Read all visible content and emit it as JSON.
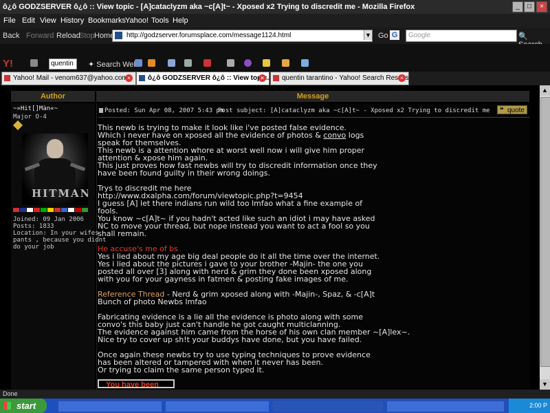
{
  "window": {
    "title": "ô¿ô GODZSERVER ô¿ô :: View topic - [A]cataclyzm aka ~c[A]t~ - Xposed x2 Trying to discredit me - Mozilla Firefox",
    "minimize": "_",
    "maximize": "□",
    "close": "×"
  },
  "menu": [
    "File",
    "Edit",
    "View",
    "History",
    "Bookmarks",
    "Yahoo!",
    "Tools",
    "Help"
  ],
  "nav": {
    "back": "Back",
    "forward": "Forward",
    "reload": "Reload",
    "stop": "Stop",
    "home": "Home",
    "url": "http://godzserver.forumsplace.com/message1124.html",
    "go": "Go",
    "search_placeholder": "Google",
    "search_button": "Search"
  },
  "yahoo_toolbar": {
    "logo": "Y!",
    "query": "quentin",
    "search_web": "Search Web"
  },
  "tabs": [
    {
      "label": "Yahoo! Mail - venom637@yahoo.com",
      "active": false
    },
    {
      "label": "ô¿ô GODZSERVER ô¿ô :: View topic...",
      "active": true
    },
    {
      "label": "quentin tarantino - Yahoo! Search Results",
      "active": false
    }
  ],
  "table_header": {
    "author": "Author",
    "message": "Message"
  },
  "author": {
    "name": "~»Hit[]Màn«~",
    "rank": "Major O-4",
    "avatar_logo": "HITMAN",
    "joined": "Joined: 09 Jan 2006",
    "posts": "Posts: 1833",
    "location_1": "Location: In your wifes",
    "location_2": "pants , because you didnt",
    "location_3": "do your job"
  },
  "post": {
    "posted": "Posted: Sun Apr 08, 2007 5:43 pm",
    "subject": "Post subject: [A]cataclyzm aka ~c[A]t~ - Xposed x2 Trying to discredit me",
    "quote": "quote",
    "l01": "This newb is trying to make it look like i've posted false evidence.",
    "l02a": "Which i never have on xposed all the evidence of photos & ",
    "l02b": "convo",
    "l02c": " logs",
    "l03": "speak for themselves.",
    "l04": "This newb is a attention whore at worst well now i will give him proper",
    "l05": "attention & xpose him again.",
    "l06": "This just proves how fast newbs will try to discredit information once they",
    "l07": "have been found guilty in their wrong doings.",
    "l08": "Trys to discredit me here",
    "l09": "http://www.dxalpha.com/forum/viewtopic.php?t=9454",
    "l10": "I guess [A] let there indians run wild too lmfao what a fine example of",
    "l11": "fools.",
    "l12": "You know ~c[A]t~ if you hadn't acted like such an idiot i may have asked",
    "l13": "NC to move your thread, but nope instead you want to act a fool so you",
    "l14": "shall remain.",
    "l15": "He accuse's me of bs",
    "l16": "Yes i lied about my age big deal people do it all the time over the internet.",
    "l17": "Yes i lied about the pictures i gave to your brother -Majin- the one you",
    "l18": "posted all over [3] along with nerd & grim they done been xposed along",
    "l19": "with you for your gayness in fatmen & posting fake images of me.",
    "l20a": "Reference Thread",
    "l20b": " - Nerd & grim xposed along with -Majin-, Spaz, & -c[A]t",
    "l21": "Bunch of photo Newbs lmfao",
    "l22": "Fabricating evidence is a lie all the evidence is photo along with some",
    "l23": "convo's this baby just can't handle he got caught multiclanning.",
    "l24": "The evidence against him came from the horse of his own clan member ~[A]lex~.",
    "l25": "Nice try to cover up sh!t your buddys have done, but you have failed.",
    "l26": "Once again these newbs try to use typing techniques to prove evidence",
    "l27": "has been altered or tampered with when it never has been.",
    "l28": "Or trying to claim the same person typed it.",
    "banner": "You have been"
  },
  "status": "Done",
  "taskbar": {
    "start": "start",
    "clock": "2:00 P"
  }
}
